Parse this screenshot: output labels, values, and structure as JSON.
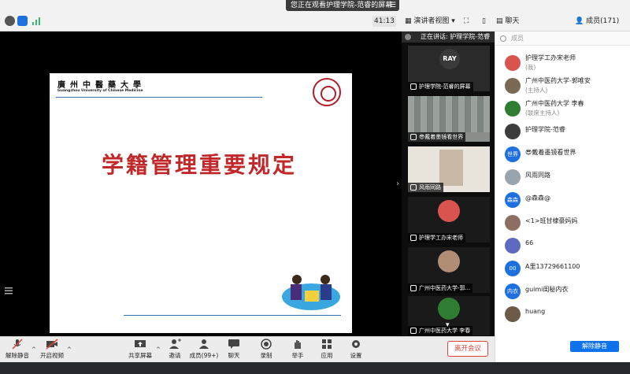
{
  "topbar": {
    "viewing_text": "您正在观看护理学院-范睿的屏幕",
    "timer": "41:13",
    "view_mode": "演讲者视图",
    "chat_tab": "聊天",
    "members_tab": "成员(171)"
  },
  "slide": {
    "header_cn": "廣州中醫藥大學",
    "header_en": "Guangzhou University of Chinese Medicine",
    "title": "学籍管理重要规定"
  },
  "gallery": {
    "speaking": "正在讲话: 护理学院-范睿",
    "tiles": [
      {
        "label": "护理学院-范睿的屏幕",
        "avatar_text": "RAY"
      },
      {
        "label": "😎戴着墨镜看世界"
      },
      {
        "label": "风雨同路"
      },
      {
        "label": "护理学工办宋老师"
      },
      {
        "label": "广州中医药大学-郭..."
      },
      {
        "label": "广州中医药大学 李春"
      }
    ]
  },
  "participants": {
    "search_placeholder": "成员",
    "list": [
      {
        "name": "护理学工办宋老师",
        "role": "(我)",
        "avatar": "",
        "color": "#d9534f"
      },
      {
        "name": "广州中医药大学-郭唯安",
        "role": "(主持人)",
        "avatar": "",
        "color": "#7a6a55"
      },
      {
        "name": "广州中医药大学 李春",
        "role": "(联席主持人)",
        "avatar": "",
        "color": "#2e7d32"
      },
      {
        "name": "护理学院-范睿",
        "role": "",
        "avatar": "",
        "color": "#3d3d3d"
      },
      {
        "name": "😎戴着墨镜看世界",
        "role": "",
        "avatar": "世界",
        "color": "#1e6fe0"
      },
      {
        "name": "风雨同路",
        "role": "",
        "avatar": "",
        "color": "#9aa4ad"
      },
      {
        "name": "@森森@",
        "role": "",
        "avatar": "森森",
        "color": "#1e6fe0"
      },
      {
        "name": "<1>班甘棣豪妈妈",
        "role": "",
        "avatar": "",
        "color": "#8d6e63"
      },
      {
        "name": "66",
        "role": "",
        "avatar": "",
        "color": "#5c6bc0"
      },
      {
        "name": "A里13729661100",
        "role": "",
        "avatar": "00",
        "color": "#1e6fe0"
      },
      {
        "name": "guimi闺秘内衣",
        "role": "",
        "avatar": "内衣",
        "color": "#1e6fe0"
      },
      {
        "name": "huang",
        "role": "",
        "avatar": "",
        "color": "#6d5a48"
      }
    ],
    "unmute_all": "解除静音"
  },
  "toolbar": {
    "unmute": "解除静音",
    "start_video": "开启视频",
    "share_screen": "共享屏幕",
    "invite": "邀请",
    "members": "成员(99+)",
    "chat": "聊天",
    "record": "录制",
    "raise_hand": "举手",
    "apps": "应用",
    "settings": "设置",
    "leave": "离开会议"
  },
  "colors": {
    "accent": "#0e72ed",
    "danger": "#e0443a",
    "slide_title": "#c0282a"
  }
}
